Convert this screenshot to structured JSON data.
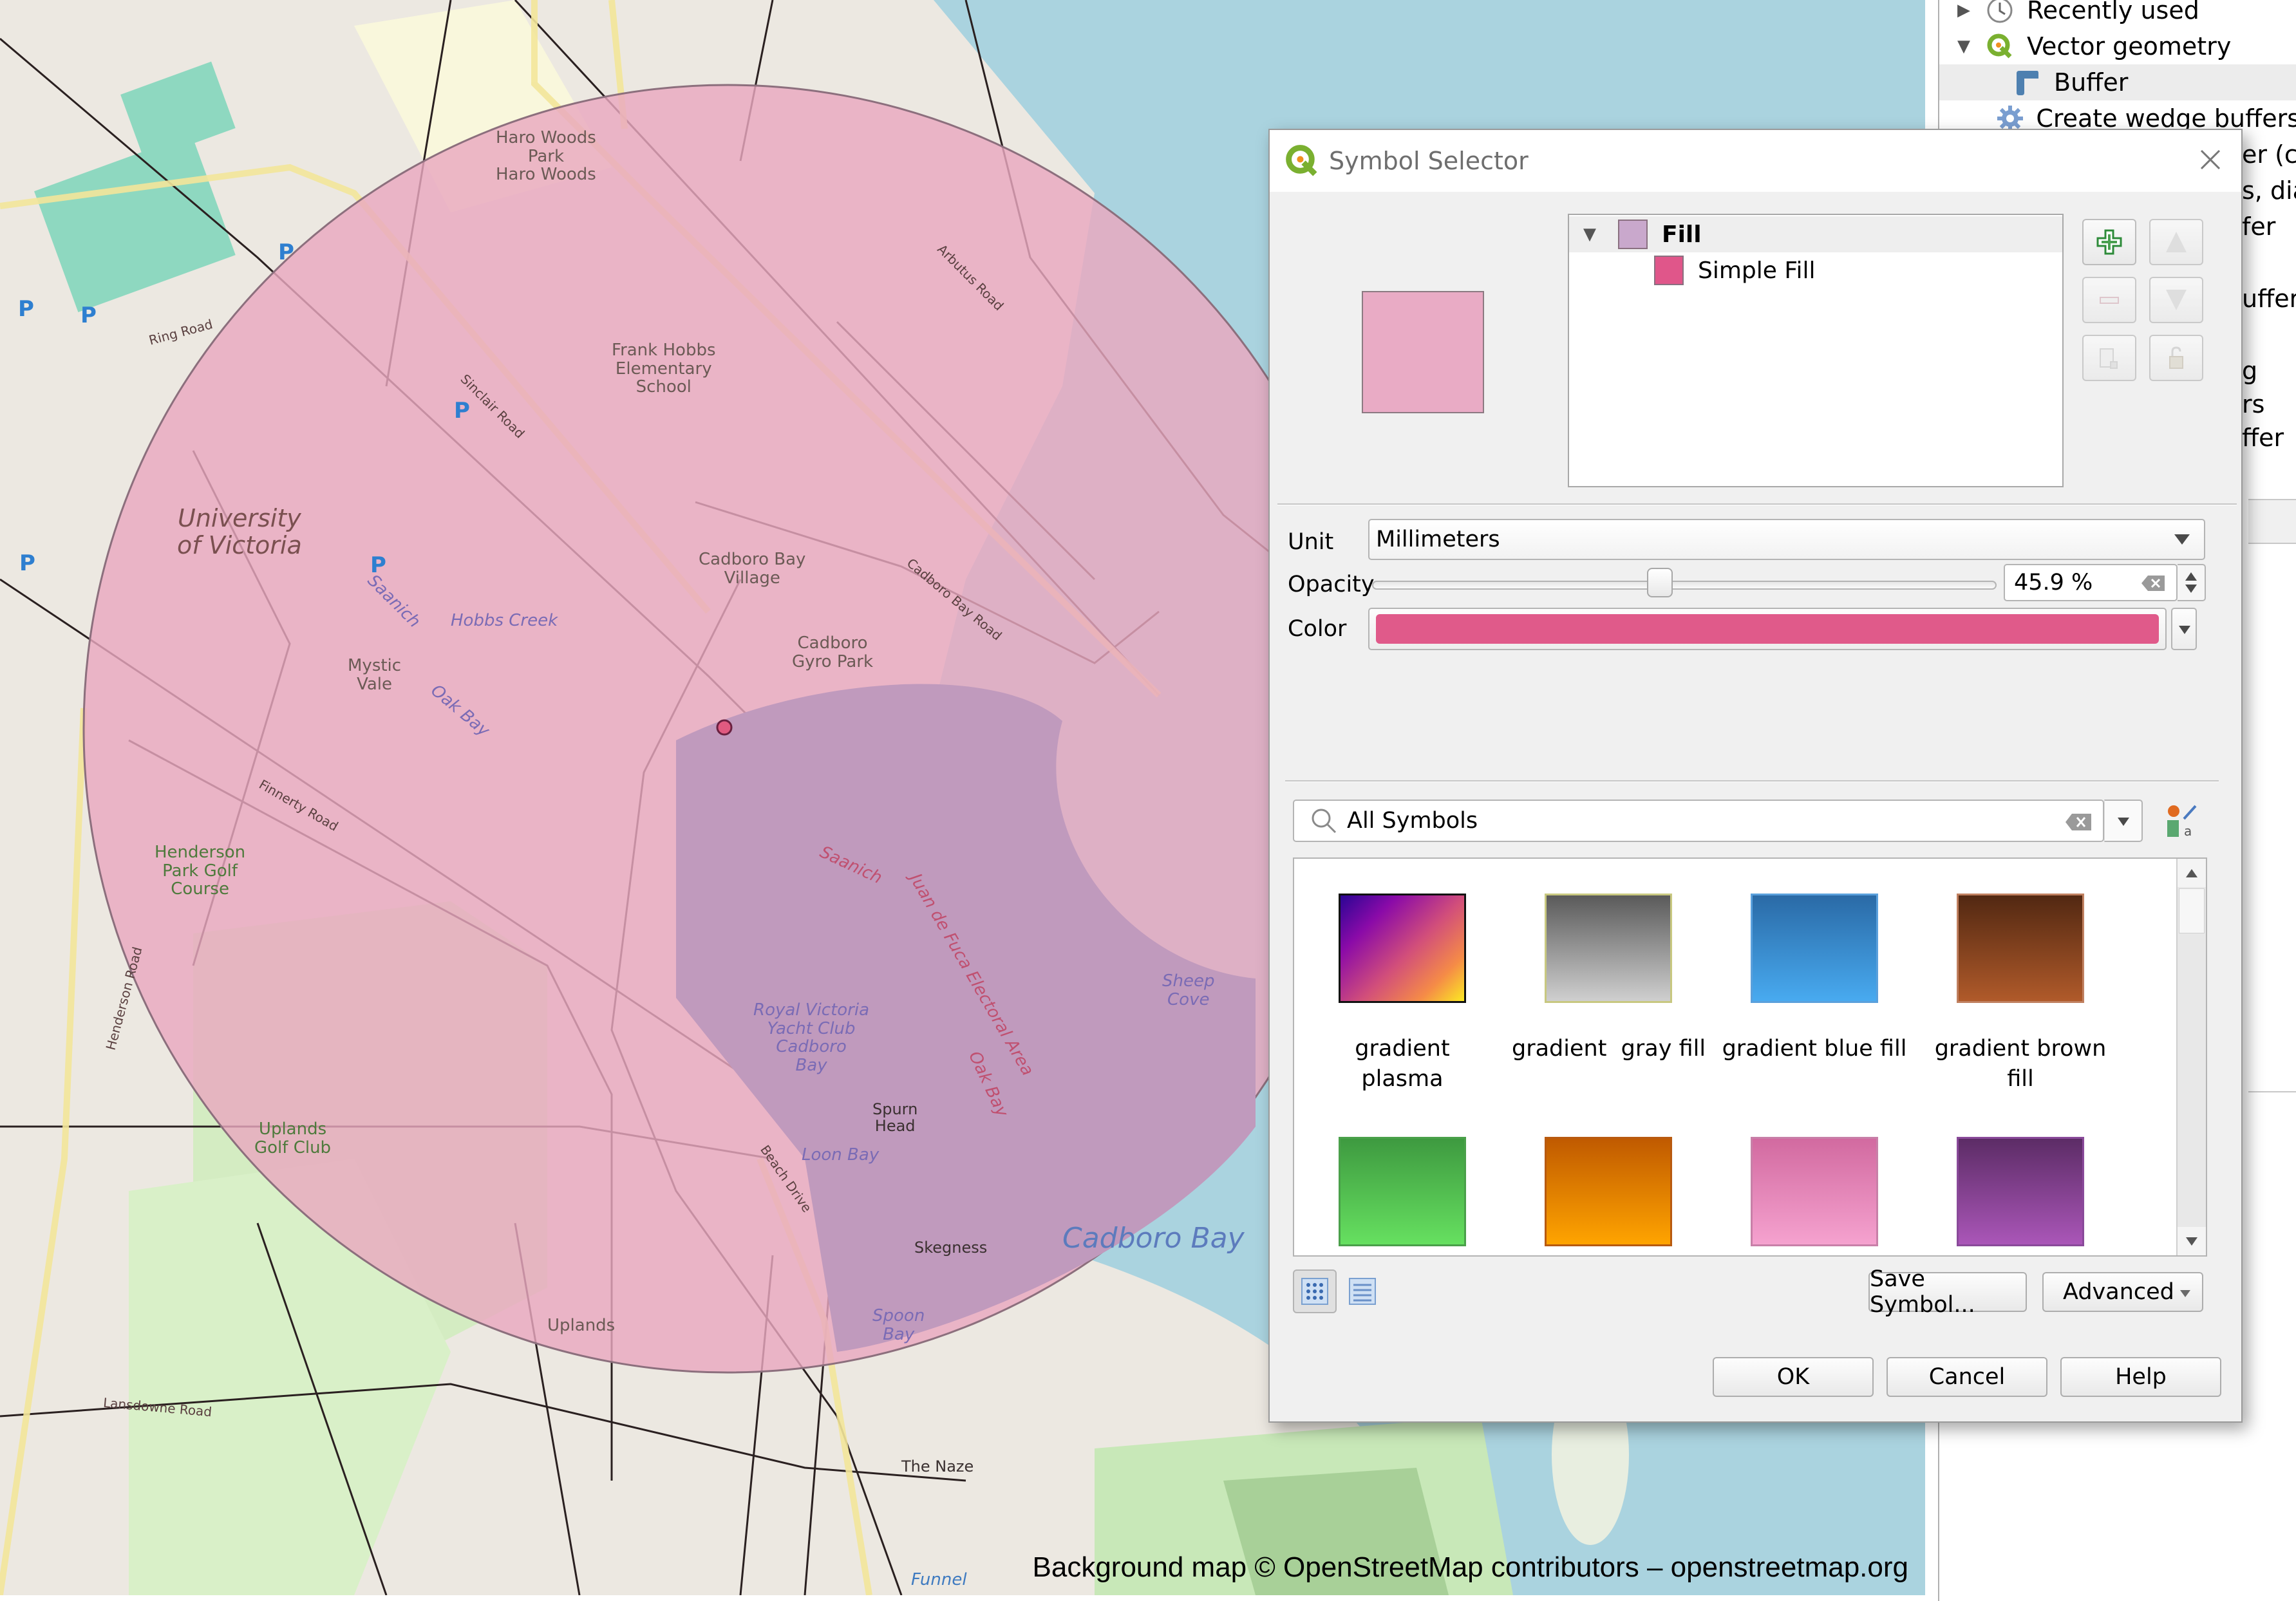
{
  "map": {
    "attribution": "Background map © OpenStreetMap contributors – openstreetmap.org",
    "buffer_fill_color": "#e9a8c0",
    "buffer_opacity_percent": 45.9,
    "labels": {
      "haro_woods": "Haro Woods\nPark\nHaro Woods",
      "frank_hobbs": "Frank Hobbs\nElementary\nSchool",
      "university": "University\nof Victoria",
      "cadboro_bay_village": "Cadboro Bay\nVillage",
      "cadboro_gyro_park": "Cadboro\nGyro Park",
      "mystic_vale": "Mystic\nVale",
      "hobbs_creek": "Hobbs Creek",
      "oak_bay_upper": "Oak Bay",
      "saanich_upper": "Saanich",
      "henderson_park": "Henderson\nPark Golf\nCourse",
      "uplands_golf": "Uplands\nGolf Club",
      "saanich_water": "Saanich",
      "juan_de_fuca": "Juan de Fuca Electoral Area",
      "oak_bay_water": "Oak Bay",
      "royal_victoria": "Royal Victoria\nYacht Club\nCadboro\nBay",
      "sheep_cove": "Sheep\nCove",
      "spurn_head": "Spurn\nHead",
      "loon_bay": "Loon Bay",
      "skegness": "Skegness",
      "spoon_bay": "Spoon\nBay",
      "cadboro_bay": "Cadboro Bay",
      "uplands": "Uplands",
      "the_naze": "The Naze",
      "funnel": "Funnel",
      "ring_road": "Ring Road",
      "arbutus_road": "Arbutus Road",
      "sinclair_road": "Sinclair Road",
      "cadboro_bay_road": "Cadboro Bay Road",
      "finnerty_road": "Finnerty Road",
      "beach_drive": "Beach Drive",
      "lansdowne_road": "Lansdowne Road",
      "henderson_road": "Henderson Road",
      "parking": "P"
    }
  },
  "toolbox": {
    "items": [
      {
        "label": "Recently used",
        "icon": "clock-icon",
        "expanded": false
      },
      {
        "label": "Vector geometry",
        "icon": "qgis-icon",
        "expanded": true
      },
      {
        "label": "Buffer",
        "icon": "buffer-icon",
        "selected": true
      },
      {
        "label": "Create wedge buffers",
        "icon": "gear-icon"
      }
    ],
    "partial_items": [
      "er (co",
      "s, dia",
      "fer",
      "uffer",
      "g",
      "rs",
      "ffer"
    ]
  },
  "dialog": {
    "title": "Symbol Selector",
    "preview_color": "#e9abc5",
    "layers": [
      {
        "label": "Fill",
        "swatch": "#c9a8cc",
        "bold": true
      },
      {
        "label": "Simple Fill",
        "swatch": "#e0568a",
        "bold": false
      }
    ],
    "unit": {
      "label": "Unit",
      "value": "Millimeters"
    },
    "opacity": {
      "label": "Opacity",
      "value_text": "45.9 %",
      "value": 45.9
    },
    "color": {
      "label": "Color",
      "value": "#e05a8a"
    },
    "search": {
      "value": "All Symbols"
    },
    "symbols": [
      {
        "label": "gradient\nplasma",
        "gradient": "linear-gradient(135deg,#2a0594 0%,#8a0aa8 25%,#d24f7a 55%,#f58b47 80%,#fbe923 100%)",
        "border": "#111111"
      },
      {
        "label": "gradient  gray fill",
        "gradient": "linear-gradient(#5a5a5a,#cfcfcf)",
        "border": "#c8c880"
      },
      {
        "label": "gradient blue fill",
        "gradient": "linear-gradient(#2a6aa6,#48aaf0)",
        "border": "#5aa0dc"
      },
      {
        "label": "gradient brown\nfill",
        "gradient": "linear-gradient(#522812,#b05a2a)",
        "border": "#c08060"
      },
      {
        "label": "",
        "gradient": "linear-gradient(#3e9a40,#66e060)",
        "border": "#4aa04a"
      },
      {
        "label": "",
        "gradient": "linear-gradient(#c05a00,#ffa400)",
        "border": "#b85a10"
      },
      {
        "label": "",
        "gradient": "linear-gradient(#d26aa0,#f5a2cf)",
        "border": "#c880a8"
      },
      {
        "label": "",
        "gradient": "linear-gradient(#5c2c66,#aa56b8)",
        "border": "#8a4a9a"
      }
    ],
    "buttons": {
      "save_symbol": "Save Symbol...",
      "advanced": "Advanced",
      "ok": "OK",
      "cancel": "Cancel",
      "help": "Help"
    }
  }
}
